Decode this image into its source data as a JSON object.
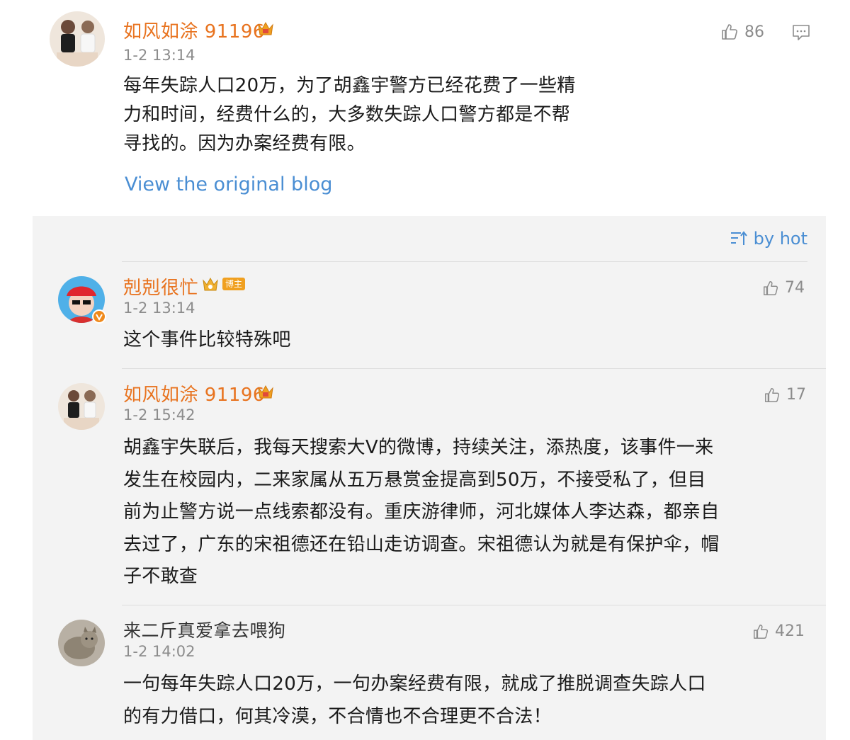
{
  "main_comment": {
    "username": "如风如涂 91196",
    "time": "1-2 13:14",
    "likes": "86",
    "text_lines": [
      "每年失踪人口20万，为了胡鑫宇警方已经花费了一些精",
      "力和时间，经费什么的，大多数失踪人口警方都是不帮",
      "寻找的。因为办案经费有限。"
    ],
    "view_original_link": "View the original blog"
  },
  "sort": {
    "label": "by hot"
  },
  "replies": [
    {
      "username": "剋剋很忙",
      "badge": "博主",
      "time": "1-2 13:14",
      "likes": "74",
      "text_lines": [
        "这个事件比较特殊吧"
      ]
    },
    {
      "username": "如风如涂 91196",
      "time": "1-2 15:42",
      "likes": "17",
      "text_lines": [
        "胡鑫宇失联后，我每天搜索大V的微博，持续关注，添热度，该事件一来",
        "发生在校园内，二来家属从五万悬赏金提高到50万，不接受私了，但目",
        "前为止警方说一点线索都没有。重庆游律师，河北媒体人李达森，都亲自",
        "去过了，广东的宋祖德还在铅山走访调查。宋祖德认为就是有保护伞，帽",
        "子不敢查"
      ]
    },
    {
      "username": "来二斤真爱拿去喂狗",
      "time": "1-2 14:02",
      "likes": "421",
      "text_lines": [
        "一句每年失踪人口20万，一句办案经费有限，就成了推脱调查失踪人口",
        "的有力借口，何其冷漠，不合情也不合理更不合法！"
      ]
    }
  ],
  "colors": {
    "username": "#e8731f",
    "link": "#4a8ed3",
    "meta": "#8c8c8c",
    "panel": "#f3f3f3"
  }
}
